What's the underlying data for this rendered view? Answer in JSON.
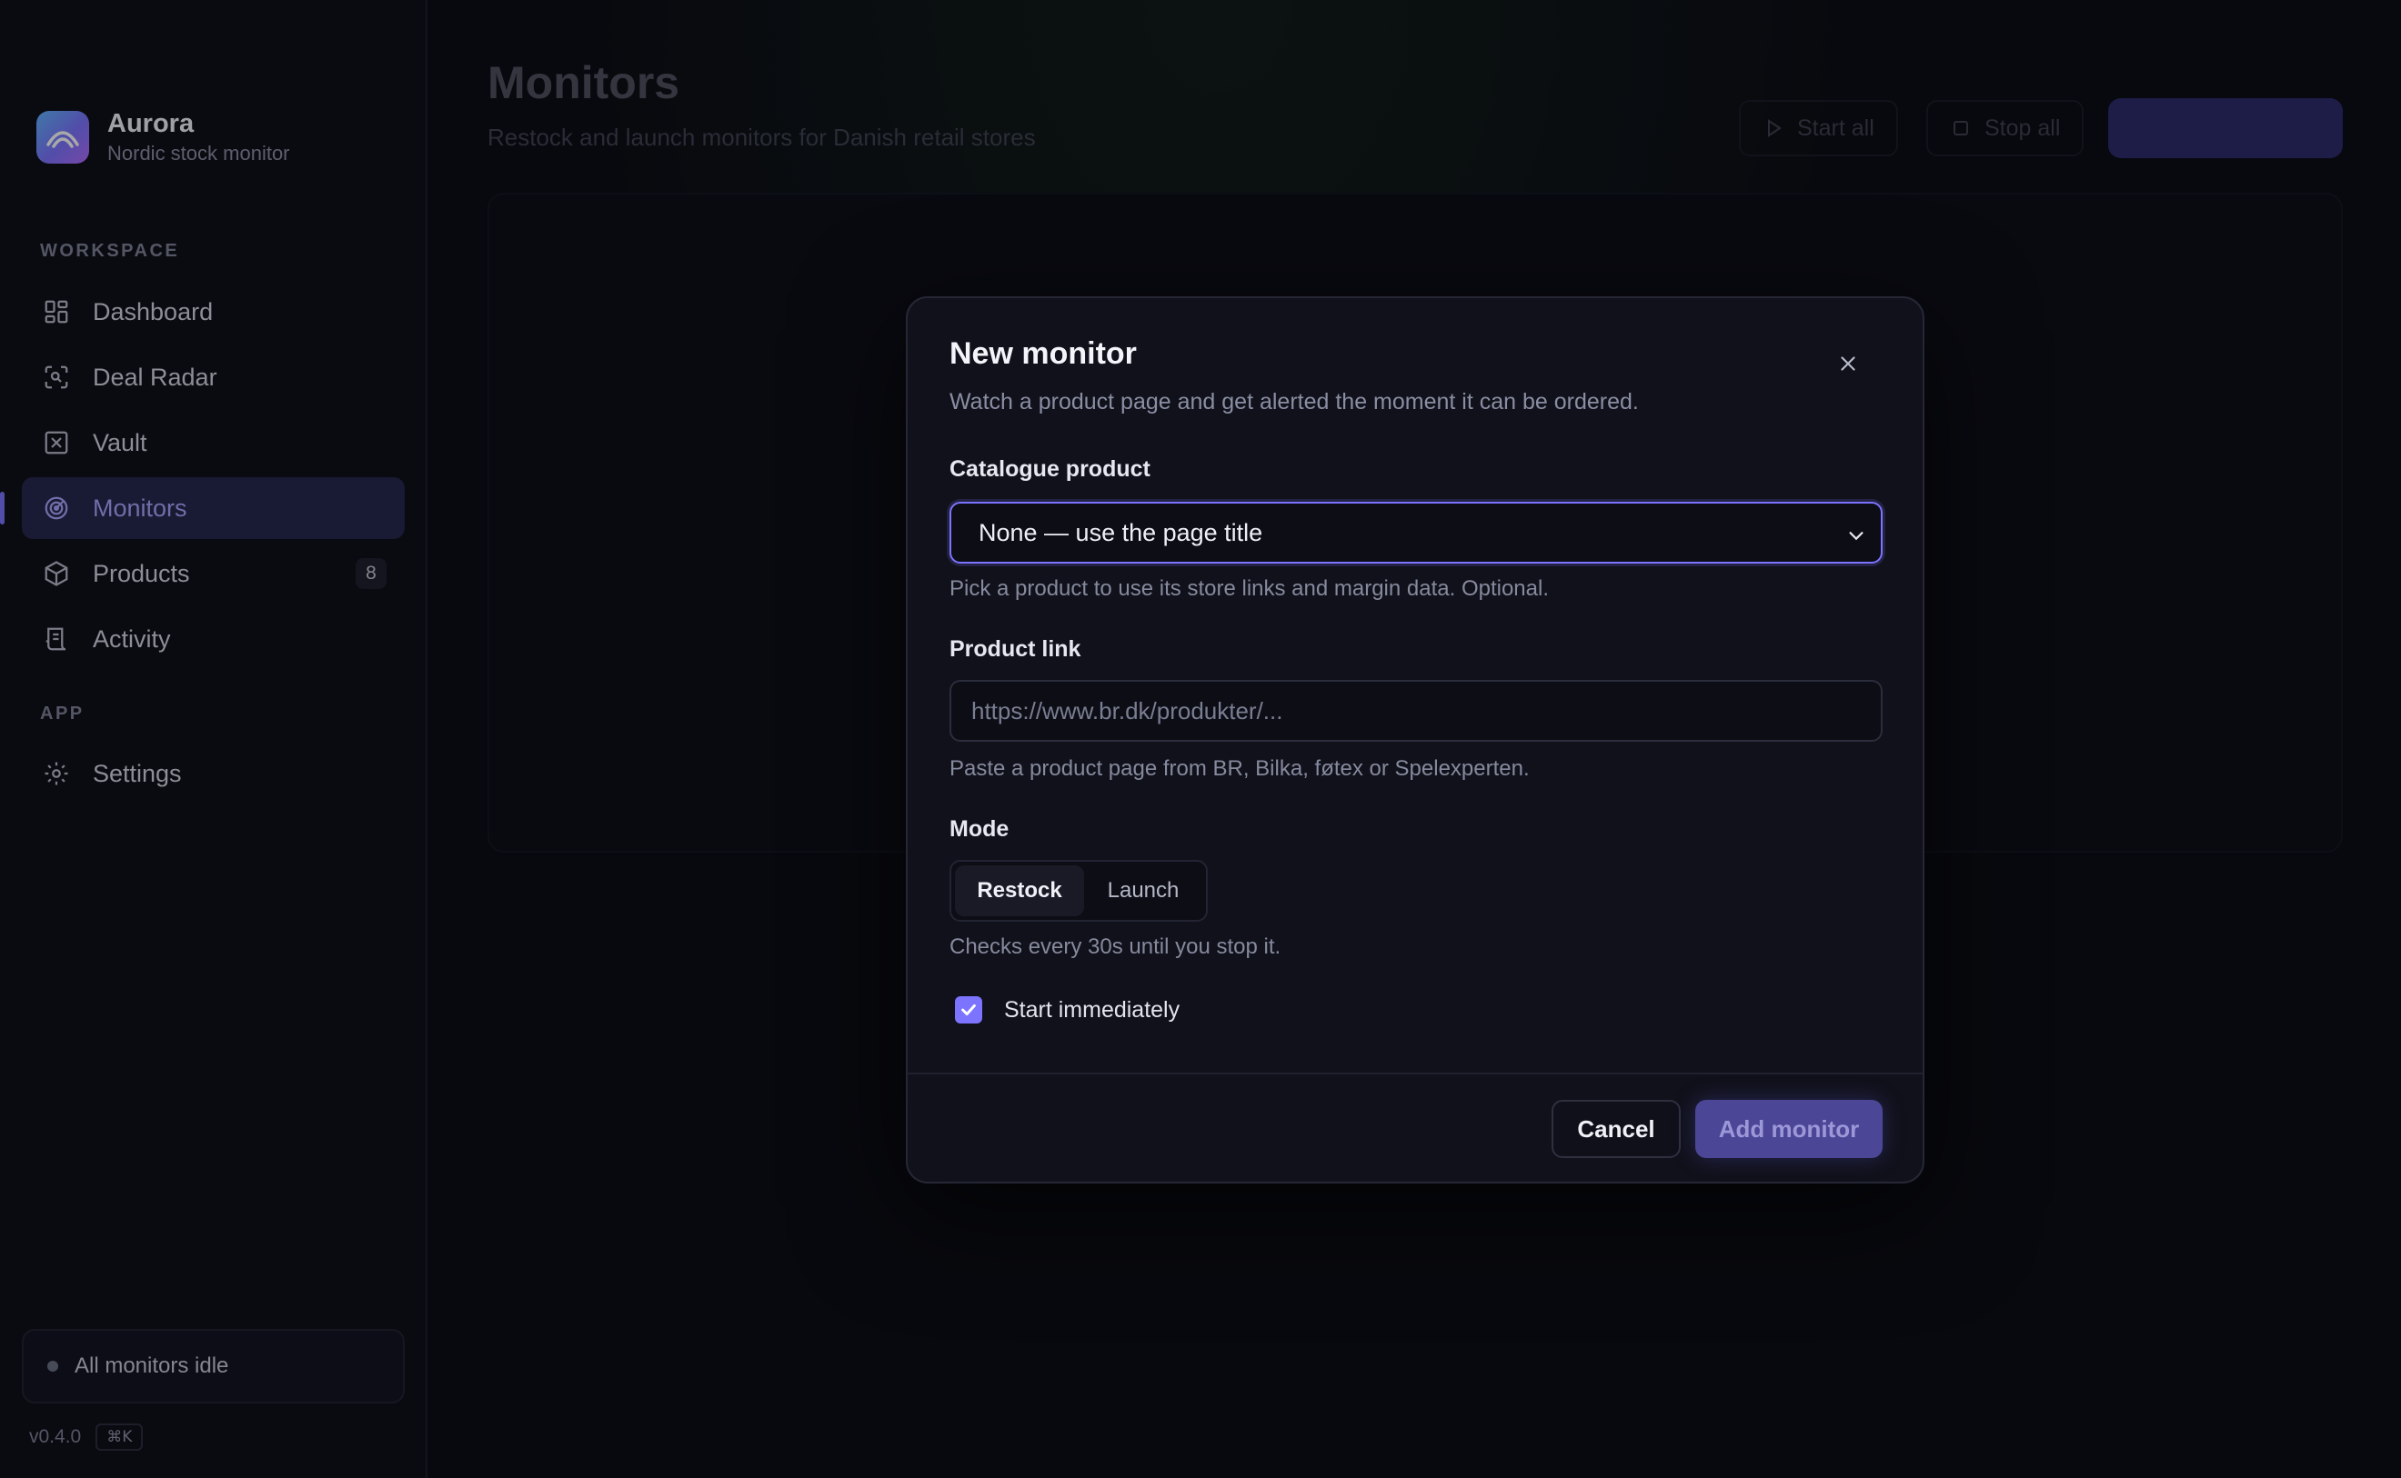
{
  "brand": {
    "name": "Aurora",
    "subtitle": "Nordic stock monitor"
  },
  "sidebar": {
    "sections": {
      "workspace": "WORKSPACE",
      "app": "APP"
    },
    "items": [
      {
        "label": "Dashboard",
        "icon": "grid-icon"
      },
      {
        "label": "Deal Radar",
        "icon": "scan-icon"
      },
      {
        "label": "Vault",
        "icon": "vault-icon"
      },
      {
        "label": "Monitors",
        "icon": "radar-icon",
        "active": true
      },
      {
        "label": "Products",
        "icon": "box-icon",
        "badge": "8"
      },
      {
        "label": "Activity",
        "icon": "receipt-icon"
      }
    ],
    "app_items": [
      {
        "label": "Settings",
        "icon": "gear-icon"
      }
    ],
    "status": "All monitors idle",
    "version": "v0.4.0",
    "shortcut": "⌘K"
  },
  "page": {
    "title": "Monitors",
    "subtitle": "Restock and launch monitors for Danish retail stores",
    "start_all": "Start all",
    "stop_all": "Stop all"
  },
  "modal": {
    "title": "New monitor",
    "subtitle": "Watch a product page and get alerted the moment it can be ordered.",
    "catalogue_label": "Catalogue product",
    "catalogue_value": "None — use the page title",
    "catalogue_help": "Pick a product to use its store links and margin data. Optional.",
    "link_label": "Product link",
    "link_placeholder": "https://www.br.dk/produkter/...",
    "link_help": "Paste a product page from BR, Bilka, føtex or Spelexperten.",
    "mode_label": "Mode",
    "mode_options": [
      "Restock",
      "Launch"
    ],
    "mode_selected": "Restock",
    "mode_help": "Checks every 30s until you stop it.",
    "start_immediately_label": "Start immediately",
    "start_immediately_checked": true,
    "cancel_label": "Cancel",
    "submit_label": "Add monitor"
  },
  "colors": {
    "accent": "#7c73ff",
    "active_bg": "#24254a",
    "modal_bg": "#10111a"
  }
}
